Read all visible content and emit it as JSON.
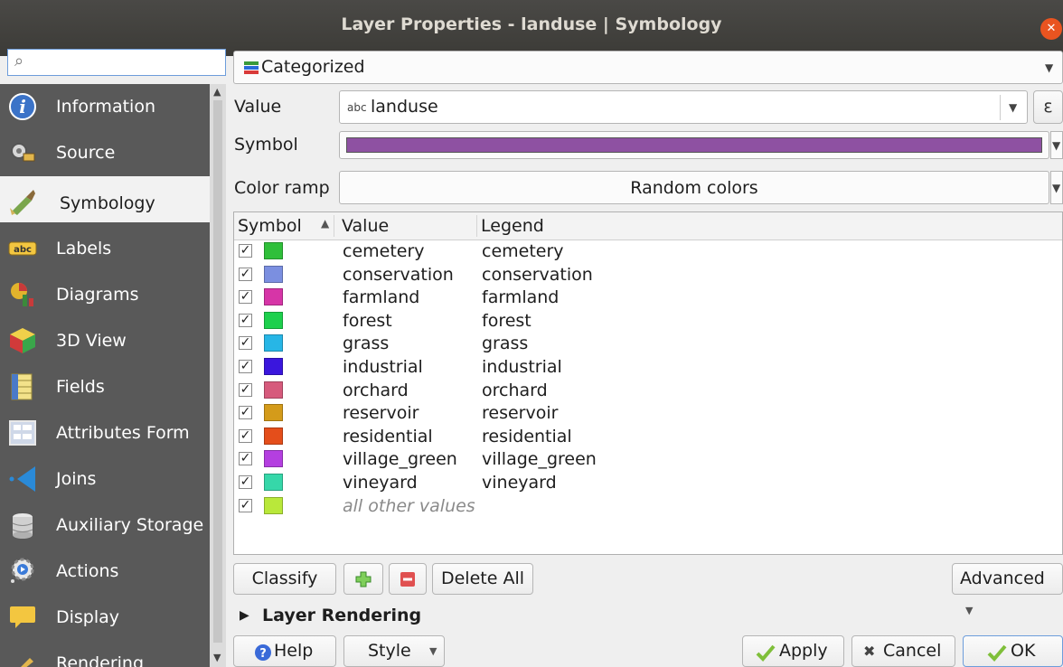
{
  "window": {
    "title": "Layer Properties - landuse | Symbology"
  },
  "sidebar": {
    "search_placeholder": "",
    "items": [
      {
        "label": "Information",
        "icon": "info-icon"
      },
      {
        "label": "Source",
        "icon": "source-icon"
      },
      {
        "label": "Symbology",
        "icon": "symbology-icon",
        "selected": true
      },
      {
        "label": "Labels",
        "icon": "labels-icon"
      },
      {
        "label": "Diagrams",
        "icon": "diagrams-icon"
      },
      {
        "label": "3D View",
        "icon": "3d-view-icon"
      },
      {
        "label": "Fields",
        "icon": "fields-icon"
      },
      {
        "label": "Attributes Form",
        "icon": "attributes-form-icon"
      },
      {
        "label": "Joins",
        "icon": "joins-icon"
      },
      {
        "label": "Auxiliary Storage",
        "icon": "auxiliary-storage-icon"
      },
      {
        "label": "Actions",
        "icon": "actions-icon"
      },
      {
        "label": "Display",
        "icon": "display-icon"
      },
      {
        "label": "Rendering",
        "icon": "rendering-icon"
      }
    ]
  },
  "renderer": {
    "type": "Categorized"
  },
  "form": {
    "value_label": "Value",
    "value_prefix": "abc",
    "value_field": "landuse",
    "expression_label": "ε",
    "symbol_label": "Symbol",
    "symbol_color": "#8e51a2",
    "color_ramp_label": "Color ramp",
    "color_ramp_value": "Random colors"
  },
  "table": {
    "headers": [
      "Symbol",
      "Value",
      "Legend"
    ],
    "rows": [
      {
        "checked": true,
        "color": "#2fbf3a",
        "value": "cemetery",
        "legend": "cemetery"
      },
      {
        "checked": true,
        "color": "#7b8fe0",
        "value": "conservation",
        "legend": "conservation"
      },
      {
        "checked": true,
        "color": "#d635a7",
        "value": "farmland",
        "legend": "farmland"
      },
      {
        "checked": true,
        "color": "#1dd04d",
        "value": "forest",
        "legend": "forest"
      },
      {
        "checked": true,
        "color": "#27b6e6",
        "value": "grass",
        "legend": "grass"
      },
      {
        "checked": true,
        "color": "#3a16dd",
        "value": "industrial",
        "legend": "industrial"
      },
      {
        "checked": true,
        "color": "#d65a7c",
        "value": "orchard",
        "legend": "orchard"
      },
      {
        "checked": true,
        "color": "#d49b1a",
        "value": "reservoir",
        "legend": "reservoir"
      },
      {
        "checked": true,
        "color": "#e44e1b",
        "value": "residential",
        "legend": "residential"
      },
      {
        "checked": true,
        "color": "#b43fe0",
        "value": "village_green",
        "legend": "village_green"
      },
      {
        "checked": true,
        "color": "#36d7a9",
        "value": "vineyard",
        "legend": "vineyard"
      },
      {
        "checked": true,
        "color": "#b9e83a",
        "value": "all other values",
        "legend": "",
        "italic": true
      }
    ]
  },
  "buttons": {
    "classify": "Classify",
    "add": "+",
    "remove": "−",
    "delete_all": "Delete All",
    "advanced": "Advanced",
    "layer_rendering": "Layer Rendering",
    "help": "Help",
    "style": "Style",
    "apply": "Apply",
    "cancel": "Cancel",
    "ok": "OK"
  },
  "colors": {
    "title_bar": "#3c3b37",
    "close": "#e95420",
    "sidebar": "#595959",
    "selection_border": "#6d9ddb"
  }
}
